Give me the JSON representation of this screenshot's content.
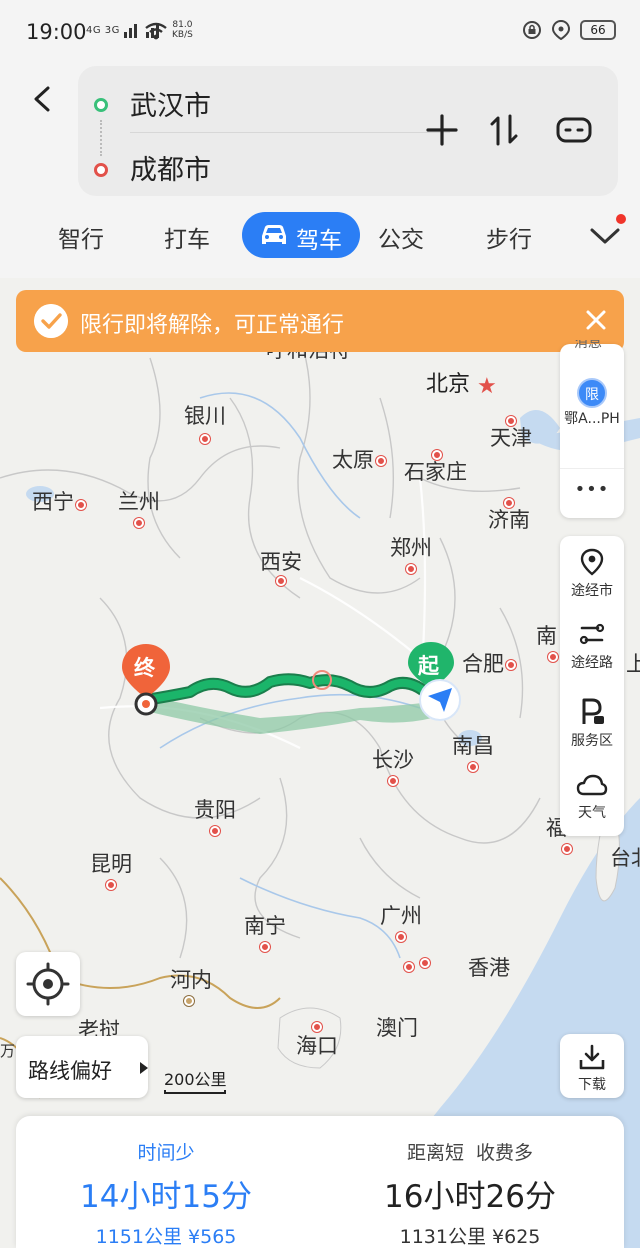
{
  "status_bar": {
    "time": "19:00",
    "network": "4G 3G",
    "speed_value": "81.0",
    "speed_unit": "KB/S",
    "battery": "66"
  },
  "route": {
    "origin": "武汉市",
    "destination": "成都市"
  },
  "modes": {
    "items": [
      "智行",
      "打车",
      "驾车",
      "公交",
      "步行"
    ],
    "active": "驾车"
  },
  "banner": {
    "text": "限行即将解除，可正常通行"
  },
  "side_panel_top": {
    "partial_label": "消息",
    "plate_badge": "限",
    "plate_label": "鄂A...PH",
    "more": "•••"
  },
  "side_panel_tools": [
    {
      "icon": "pin-icon",
      "label": "途经市"
    },
    {
      "icon": "route-icon",
      "label": "途经路"
    },
    {
      "icon": "service-area-icon",
      "label": "服务区"
    },
    {
      "icon": "cloud-icon",
      "label": "天气"
    }
  ],
  "map": {
    "cities": {
      "hohhot": "呼和浩特",
      "beijing": "北京",
      "tianjin": "天津",
      "yinchuan": "银川",
      "taiyuan": "太原",
      "shijiazhuang": "石家庄",
      "xining": "西宁",
      "lanzhou": "兰州",
      "jinan": "济南",
      "xian": "西安",
      "zhengzhou": "郑州",
      "nanjing_partial": "南",
      "hefei": "合肥",
      "shanghai_partial": "上",
      "changsha": "长沙",
      "nanchang": "南昌",
      "fuzhou_partial": "福",
      "guiyang": "贵阳",
      "kunming": "昆明",
      "taibei_partial": "台北",
      "nanning": "南宁",
      "guangzhou": "广州",
      "hongkong": "香港",
      "hanoi": "河内",
      "laos_partial": "老挝",
      "macau": "澳门",
      "haikou": "海口",
      "left_edge_partial": "万"
    },
    "start_marker": "起",
    "end_marker": "终",
    "scale": "200公里"
  },
  "controls": {
    "route_pref": "路线偏好",
    "download": "下载"
  },
  "options": [
    {
      "tag": "时间少",
      "duration": "14小时15分",
      "distance": "1151公里",
      "toll": "¥565"
    },
    {
      "tag": "距离短  收费多",
      "duration": "16小时26分",
      "distance": "1131公里",
      "toll": "¥625"
    }
  ],
  "colors": {
    "accent": "#2b7ef5",
    "route": "#1bb56a",
    "banner": "#f7a24b",
    "end_marker": "#f0643a",
    "start_marker": "#20b56b"
  }
}
